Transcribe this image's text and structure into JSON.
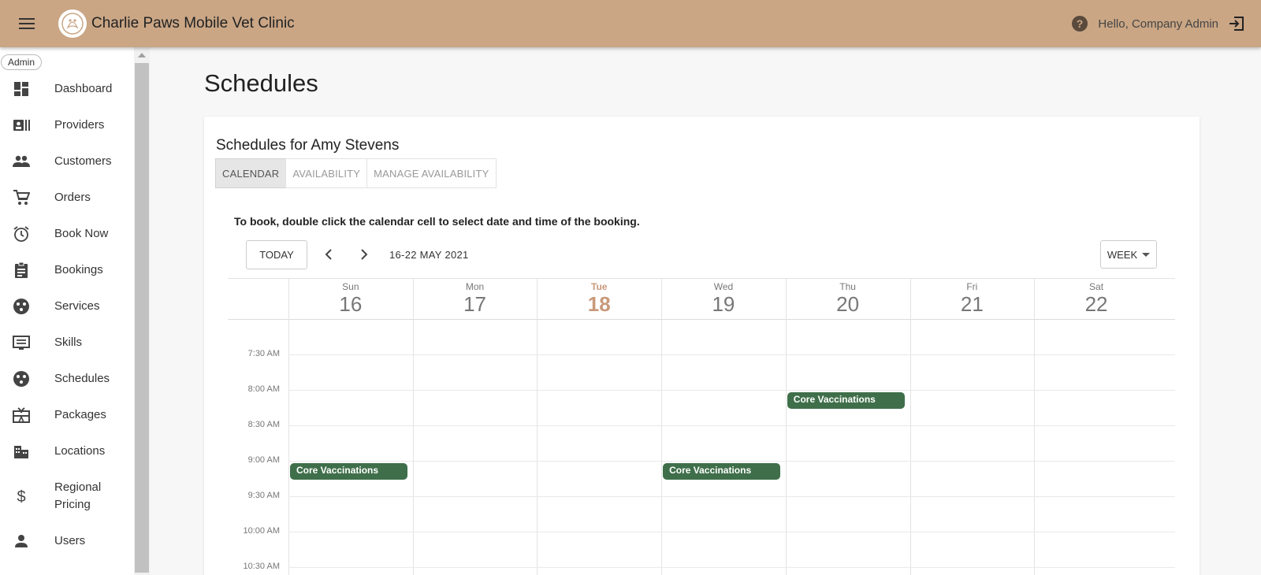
{
  "header": {
    "title": "Charlie Paws Mobile Vet Clinic",
    "greeting": "Hello, Company Admin",
    "brand_color": "#caa685"
  },
  "sidebar": {
    "role": "Admin",
    "items": [
      {
        "label": "Dashboard",
        "icon": "dashboard-icon"
      },
      {
        "label": "Providers",
        "icon": "contact-card-icon"
      },
      {
        "label": "Customers",
        "icon": "people-icon"
      },
      {
        "label": "Orders",
        "icon": "cart-icon"
      },
      {
        "label": "Book Now",
        "icon": "alarm-clock-icon"
      },
      {
        "label": "Bookings",
        "icon": "clipboard-icon"
      },
      {
        "label": "Services",
        "icon": "circle-dots-icon"
      },
      {
        "label": "Skills",
        "icon": "list-screen-icon"
      },
      {
        "label": "Schedules",
        "icon": "circle-dots-icon"
      },
      {
        "label": "Packages",
        "icon": "gift-card-icon"
      },
      {
        "label": "Locations",
        "icon": "buildings-icon"
      },
      {
        "label": "Regional Pricing",
        "icon": "dollar-icon"
      },
      {
        "label": "Users",
        "icon": "person-icon"
      }
    ]
  },
  "main": {
    "title": "Schedules",
    "card_title": "Schedules for Amy Stevens",
    "tabs": [
      {
        "label": "CALENDAR",
        "active": true
      },
      {
        "label": "AVAILABILITY",
        "active": false
      },
      {
        "label": "MANAGE AVAILABILITY",
        "active": false
      }
    ],
    "hint": "To book, double click the calendar cell to select date and time of the booking.",
    "toolbar": {
      "today_label": "TODAY",
      "range_label": "16-22 MAY 2021",
      "view_label": "WEEK"
    },
    "calendar": {
      "days": [
        {
          "name": "Sun",
          "num": "16",
          "today": false
        },
        {
          "name": "Mon",
          "num": "17",
          "today": false
        },
        {
          "name": "Tue",
          "num": "18",
          "today": true
        },
        {
          "name": "Wed",
          "num": "19",
          "today": false
        },
        {
          "name": "Thu",
          "num": "20",
          "today": false
        },
        {
          "name": "Fri",
          "num": "21",
          "today": false
        },
        {
          "name": "Sat",
          "num": "22",
          "today": false
        }
      ],
      "times": [
        "7:30 AM",
        "8:00 AM",
        "8:30 AM",
        "9:00 AM",
        "9:30 AM",
        "10:00 AM",
        "10:30 AM"
      ],
      "events": [
        {
          "title": "Core Vaccinations",
          "day": 0,
          "start": "9:00 AM"
        },
        {
          "title": "Core Vaccinations",
          "day": 3,
          "start": "9:00 AM"
        },
        {
          "title": "Core Vaccinations",
          "day": 4,
          "start": "8:00 AM"
        }
      ],
      "event_color": "#3f6f4a",
      "today_color": "#c8997a"
    }
  }
}
